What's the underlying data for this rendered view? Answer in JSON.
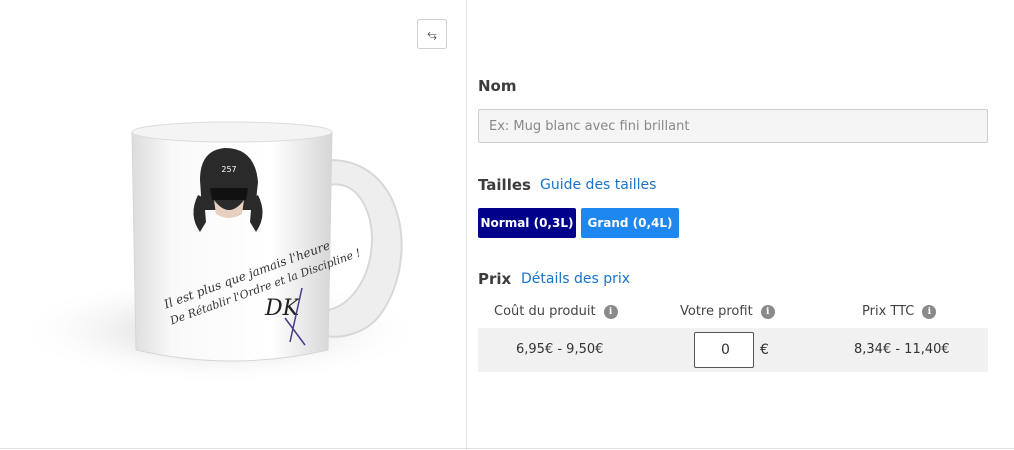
{
  "product": {
    "name_label": "Nom",
    "name_placeholder": "Ex: Mug blanc avec fini brillant",
    "sizes_label": "Tailles",
    "size_guide_link": "Guide des tailles",
    "sizes": [
      {
        "label": "Normal (0,3L)",
        "selected": true
      },
      {
        "label": "Grand (0,4L)",
        "selected": false
      }
    ],
    "price_label": "Prix",
    "price_details_link": "Détails des prix"
  },
  "pricing": {
    "columns": [
      "Coût du produit",
      "Votre profit",
      "Prix TTC"
    ],
    "product_cost": "6,95€ - 9,50€",
    "profit_value": "0",
    "currency": "€",
    "price_ttc": "8,34€ - 11,40€"
  },
  "mug_print": {
    "hat_number": "257",
    "line1": "Il est plus que jamais l'heure",
    "line2": "De Rétablir l'Ordre et la Discipline !",
    "signature": "DK"
  },
  "colors": {
    "selected_size": "#00008b",
    "size_button": "#1e87f0",
    "link": "#1a73c9"
  },
  "icons": {
    "swap": "swap-horizontal-icon",
    "info": "info-icon"
  }
}
